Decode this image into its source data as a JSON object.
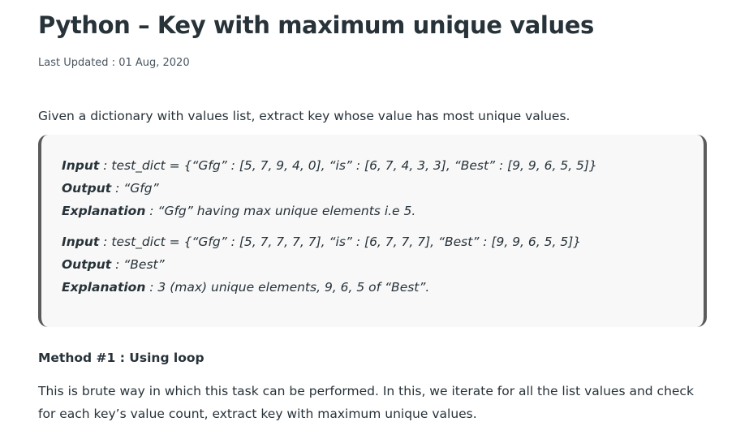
{
  "article": {
    "title": "Python – Key with maximum unique values",
    "last_updated": "Last Updated : 01 Aug, 2020",
    "intro": "Given a dictionary with values list, extract key whose value has most unique values."
  },
  "examples": [
    {
      "input_label": "Input",
      "input_text": " : test_dict = {“Gfg” : [5, 7, 9, 4, 0], “is” : [6, 7, 4, 3, 3], “Best” : [9, 9, 6, 5, 5]}",
      "output_label": "Output",
      "output_text": " : “Gfg”",
      "explanation_label": "Explanation",
      "explanation_text": " : “Gfg” having max unique elements i.e 5."
    },
    {
      "input_label": "Input",
      "input_text": " : test_dict = {“Gfg” : [5, 7, 7, 7, 7], “is” : [6, 7, 7, 7], “Best” : [9, 9, 6, 5, 5]}",
      "output_label": "Output",
      "output_text": " : “Best”",
      "explanation_label": "Explanation",
      "explanation_text": " : 3 (max) unique elements, 9, 6, 5 of “Best”."
    }
  ],
  "method": {
    "heading": "Method #1 : Using loop",
    "description": "This is brute way in which this task can be performed. In this, we iterate for all the list values and check for each key’s value count, extract key with maximum unique values."
  }
}
